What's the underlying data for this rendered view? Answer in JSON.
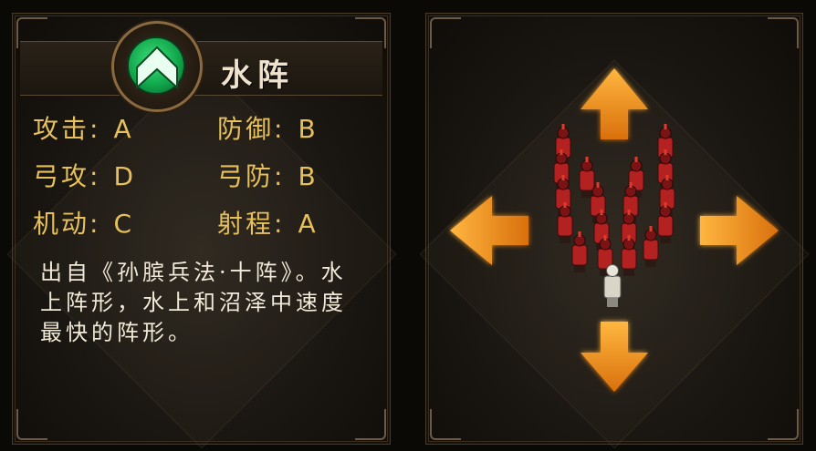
{
  "formation": {
    "name": "水阵",
    "emblem_icon": "green-chevron-up-emblem-icon"
  },
  "stats": [
    {
      "label": "攻击",
      "sep": ":",
      "value": "A"
    },
    {
      "label": "防御",
      "sep": ":",
      "value": "B"
    },
    {
      "label": "弓攻",
      "sep": ":",
      "value": "D"
    },
    {
      "label": "弓防",
      "sep": ":",
      "value": "B"
    },
    {
      "label": "机动",
      "sep": ":",
      "value": "C"
    },
    {
      "label": "射程",
      "sep": ":",
      "value": "A"
    }
  ],
  "description": "出自《孙膑兵法·十阵》。水上阵形，水上和沼泽中速度最快的阵形。",
  "preview": {
    "arrow_icons": [
      "arrow-up-icon",
      "arrow-down-icon",
      "arrow-left-icon",
      "arrow-right-icon"
    ],
    "soldier_count": 18,
    "general_count": 1
  },
  "colors": {
    "stat_gold": "#e6c05a",
    "arrow_orange": "#f59a1e",
    "emblem_green": "#11a84c",
    "soldier_red": "#b32121"
  }
}
